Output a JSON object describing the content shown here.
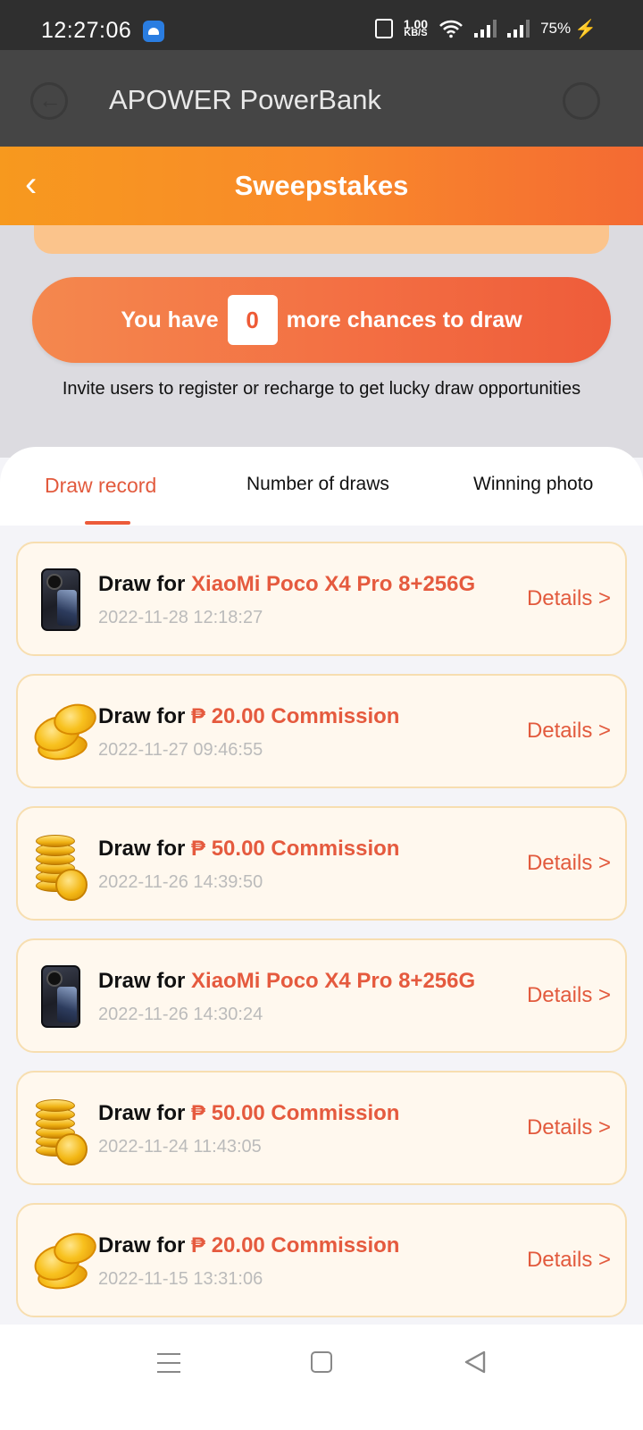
{
  "status_bar": {
    "time": "12:27:06",
    "speed_value": "1.00",
    "speed_unit": "KB/S",
    "battery": "75%"
  },
  "app_header": {
    "title": "APOWER PowerBank"
  },
  "page_header": {
    "title": "Sweepstakes"
  },
  "chances": {
    "prefix": "You have",
    "count": "0",
    "suffix": "more chances to draw",
    "hint": "Invite users to register or recharge to get lucky draw opportunities"
  },
  "tabs": [
    {
      "label": "Draw record",
      "active": true
    },
    {
      "label": "Number of draws",
      "active": false
    },
    {
      "label": "Winning photo",
      "active": false
    }
  ],
  "records": [
    {
      "thumb": "phone-image",
      "prefix": "Draw for",
      "prize": "XiaoMi Poco X4 Pro 8+256G",
      "date": "2022-11-28 12:18:27",
      "details": "Details >"
    },
    {
      "thumb": "coins-pile-image",
      "prefix": "Draw for",
      "prize": "₱ 20.00 Commission",
      "date": "2022-11-27 09:46:55",
      "details": "Details >"
    },
    {
      "thumb": "coin-stack-image",
      "prefix": "Draw for",
      "prize": "₱ 50.00 Commission",
      "date": "2022-11-26 14:39:50",
      "details": "Details >"
    },
    {
      "thumb": "phone-image",
      "prefix": "Draw for",
      "prize": "XiaoMi Poco X4 Pro 8+256G",
      "date": "2022-11-26 14:30:24",
      "details": "Details >"
    },
    {
      "thumb": "coin-stack-image",
      "prefix": "Draw for",
      "prize": "₱ 50.00 Commission",
      "date": "2022-11-24 11:43:05",
      "details": "Details >"
    },
    {
      "thumb": "coins-pile-image",
      "prefix": "Draw for",
      "prize": "₱ 20.00 Commission",
      "date": "2022-11-15 13:31:06",
      "details": "Details >"
    }
  ],
  "colors": {
    "accent": "#e25a3d",
    "header_orange": "#f98a2a",
    "card_bg": "#fff8ee",
    "card_border": "#f7deb0"
  }
}
